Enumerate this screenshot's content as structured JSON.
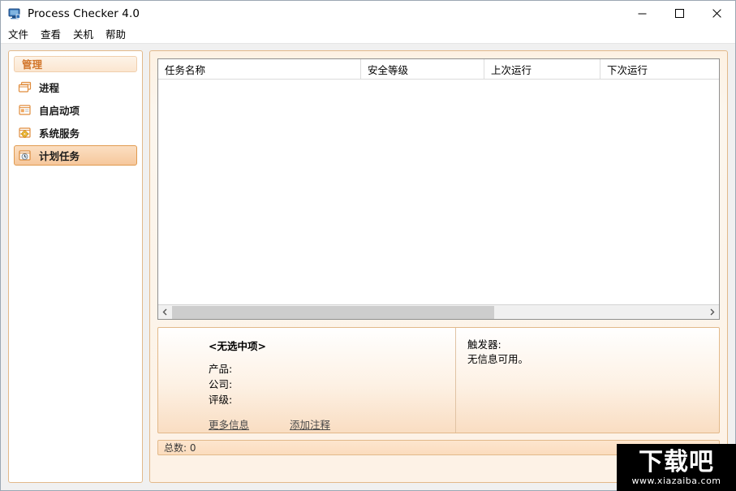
{
  "window": {
    "title": "Process Checker 4.0",
    "app_icon": "monitor-icon",
    "caption": {
      "minimize": "minimize-icon",
      "maximize": "maximize-icon",
      "close": "close-icon"
    }
  },
  "menubar": {
    "items": [
      {
        "label": "文件"
      },
      {
        "label": "查看"
      },
      {
        "label": "关机"
      },
      {
        "label": "帮助"
      }
    ]
  },
  "sidebar": {
    "group_title": "管理",
    "items": [
      {
        "label": "进程",
        "icon": "windows-stack-icon",
        "selected": false
      },
      {
        "label": "自启动项",
        "icon": "window-list-icon",
        "selected": false
      },
      {
        "label": "系统服务",
        "icon": "window-gear-icon",
        "selected": false
      },
      {
        "label": "计划任务",
        "icon": "window-clock-icon",
        "selected": true
      }
    ]
  },
  "list": {
    "columns": [
      {
        "label": "任务名称"
      },
      {
        "label": "安全等级"
      },
      {
        "label": "上次运行"
      },
      {
        "label": "下次运行"
      }
    ],
    "rows": [],
    "scrollbar": {
      "left_arrow": "chevron-left-icon",
      "right_arrow": "chevron-right-icon",
      "thumb_percent": 60
    }
  },
  "details": {
    "title": "<无选中项>",
    "fields": [
      {
        "label": "产品:"
      },
      {
        "label": "公司:"
      },
      {
        "label": "评级:"
      }
    ],
    "links": [
      {
        "label": "更多信息"
      },
      {
        "label": "添加注释"
      }
    ],
    "trigger_title": "触发器:",
    "trigger_text": "无信息可用。"
  },
  "statusbar": {
    "text": "总数: 0"
  },
  "watermark": {
    "main": "下载吧",
    "sub": "www.xiazaiba.com"
  },
  "colors": {
    "accent_orange": "#d2762b",
    "panel_border": "#e2b98a",
    "selected_border": "#e09a4f",
    "window_border": "#9ba7b3"
  }
}
